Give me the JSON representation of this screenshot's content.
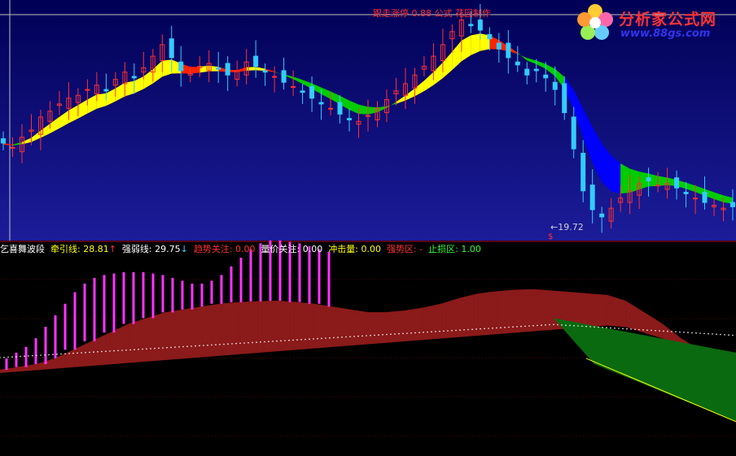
{
  "indicator": {
    "name": "乞喜舞波段",
    "items": [
      {
        "label": "牵引线",
        "value": "28.81",
        "suffix": "↑",
        "color": "#ffff00",
        "suffix_color": "#ff3030"
      },
      {
        "label": "强弱线",
        "value": "29.75",
        "suffix": "↓",
        "color": "#ffffff",
        "suffix_color": "#33ccff"
      },
      {
        "label": "趋势关注",
        "value": "0.00",
        "suffix": "",
        "color": "#ff3030",
        "suffix_color": "#ff3030"
      },
      {
        "label": "量价关注",
        "value": "0.00",
        "suffix": "",
        "color": "#ffffff",
        "suffix_color": "#ffffff"
      },
      {
        "label": "冲击量",
        "value": "0.00",
        "suffix": "",
        "color": "#ffff00",
        "suffix_color": "#ffff00"
      },
      {
        "label": "强势区",
        "value": "-",
        "suffix": "",
        "color": "#ff3030",
        "suffix_color": "#ff3030"
      },
      {
        "label": "止损区",
        "value": "1.00",
        "suffix": "",
        "color": "#33ff33",
        "suffix_color": "#33ff33"
      }
    ]
  },
  "price_annotation": "←19.72",
  "top_annotation": "跟走涨停 0.88 公式 花园制作",
  "dollar_mark": "$",
  "logo": {
    "title": "分析家公式网",
    "url": "www.88gs.com"
  },
  "colors": {
    "upper_bg_top": "#000066",
    "upper_bg_bottom": "#1a1a99",
    "candle_up": "#ff3030",
    "candle_down": "#33ccff",
    "line_yellow": "#ffff00",
    "line_red": "#ff2200",
    "line_blue": "#0000ff",
    "line_green": "#00cc00",
    "hist_magenta": "#ff33ff",
    "hist_yellow": "#ffff33",
    "area_red": "#8b1a1a",
    "area_green": "#0a6a10"
  },
  "chart_data": [
    {
      "type": "candlestick",
      "description_series": [
        {
          "name": "candles_close",
          "values": [
            24.9,
            24.6,
            25.3,
            25.8,
            26.7,
            27.1,
            27.6,
            28.0,
            28.2,
            28.6,
            28.9,
            28.5,
            29.3,
            29.8,
            29.4,
            30.1,
            30.9,
            31.7,
            30.8,
            29.9,
            29.7,
            30.2,
            30.4,
            30.0,
            29.6,
            29.9,
            30.5,
            30.2,
            29.8,
            29.5,
            29.1,
            28.8,
            28.4,
            28.0,
            27.6,
            27.3,
            26.9,
            26.5,
            26.4,
            26.8,
            27.3,
            27.9,
            28.5,
            29.0,
            29.6,
            30.2,
            30.9,
            31.7,
            32.6,
            33.4,
            33.0,
            32.7,
            32.1,
            31.4,
            30.8,
            30.3,
            29.6,
            29.9,
            29.4,
            28.6,
            27.0,
            24.5,
            21.6,
            20.3,
            19.8,
            20.4,
            21.1,
            21.6,
            22.1,
            22.3,
            22.0,
            22.1,
            21.8,
            21.4,
            21.1,
            20.8,
            20.6,
            20.4,
            20.5
          ]
        }
      ],
      "annotations": [
        "←19.72"
      ]
    },
    {
      "type": "area",
      "series": [
        {
          "name": "upper_band",
          "values": [
            4,
            5,
            6,
            8,
            11,
            14,
            17,
            20,
            22,
            24,
            25,
            26,
            27,
            27.5,
            27.8,
            28,
            27.6,
            27,
            26,
            25,
            24,
            24,
            24.6,
            25.6,
            27,
            29,
            30.5,
            31.3,
            31.8,
            32,
            31.5,
            31,
            30.5,
            30,
            28,
            24,
            20,
            15,
            11,
            7,
            3
          ]
        },
        {
          "name": "lower_band",
          "values": [
            3,
            3.5,
            4,
            4.5,
            5,
            5.5,
            6,
            6.5,
            7,
            7.5,
            8,
            8.5,
            9,
            9.5,
            10,
            10.5,
            11,
            11.5,
            12,
            12.5,
            13,
            13.5,
            14,
            14.5,
            15,
            15.5,
            16,
            16.5,
            17,
            17.5,
            18,
            18.5,
            19,
            19.5,
            19,
            17,
            15,
            13,
            11,
            9,
            7
          ]
        },
        {
          "name": "histogram",
          "values": [
            0,
            2,
            4,
            7,
            11,
            15,
            19,
            23,
            26,
            28,
            29,
            29.5,
            30,
            30,
            30,
            29.5,
            29,
            28,
            27,
            26,
            26,
            27,
            29,
            32,
            35,
            38,
            40,
            41,
            41,
            40.5,
            40,
            39,
            38,
            37
          ]
        }
      ]
    }
  ]
}
